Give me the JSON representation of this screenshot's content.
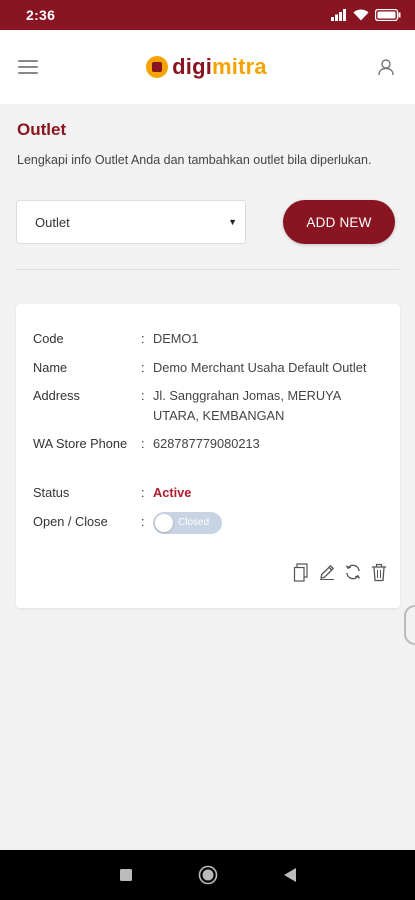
{
  "status_bar": {
    "time": "2:36"
  },
  "header": {
    "logo_part1": "digi",
    "logo_part2": "mitra"
  },
  "page": {
    "title": "Outlet",
    "description": "Lengkapi info Outlet Anda dan tambahkan outlet bila diperlukan."
  },
  "outlet_select": {
    "value": "Outlet"
  },
  "add_button": {
    "label": "ADD NEW"
  },
  "outlet": {
    "code_label": "Code",
    "code": "DEMO1",
    "name_label": "Name",
    "name": "Demo Merchant Usaha Default Outlet",
    "address_label": "Address",
    "address": "Jl. Sanggrahan Jomas, MERUYA UTARA, KEMBANGAN",
    "phone_label": "WA Store Phone",
    "phone": "628787779080213",
    "status_label": "Status",
    "status": "Active",
    "open_label": "Open / Close",
    "open_state": "Closed",
    "colon": ":"
  },
  "colors": {
    "brand": "#8a1522",
    "accent": "#f5a300",
    "status_active": "#b01e2f",
    "toggle_off": "#c8d3e4"
  },
  "icons": {
    "status": [
      "signal-icon",
      "wifi-icon",
      "battery-icon"
    ],
    "header": [
      "menu-icon",
      "logo-icon",
      "user-icon"
    ],
    "card_actions": [
      "copy-icon",
      "edit-icon",
      "sync-icon",
      "delete-icon"
    ],
    "nav": [
      "recent-apps-icon",
      "home-icon",
      "back-icon"
    ]
  }
}
